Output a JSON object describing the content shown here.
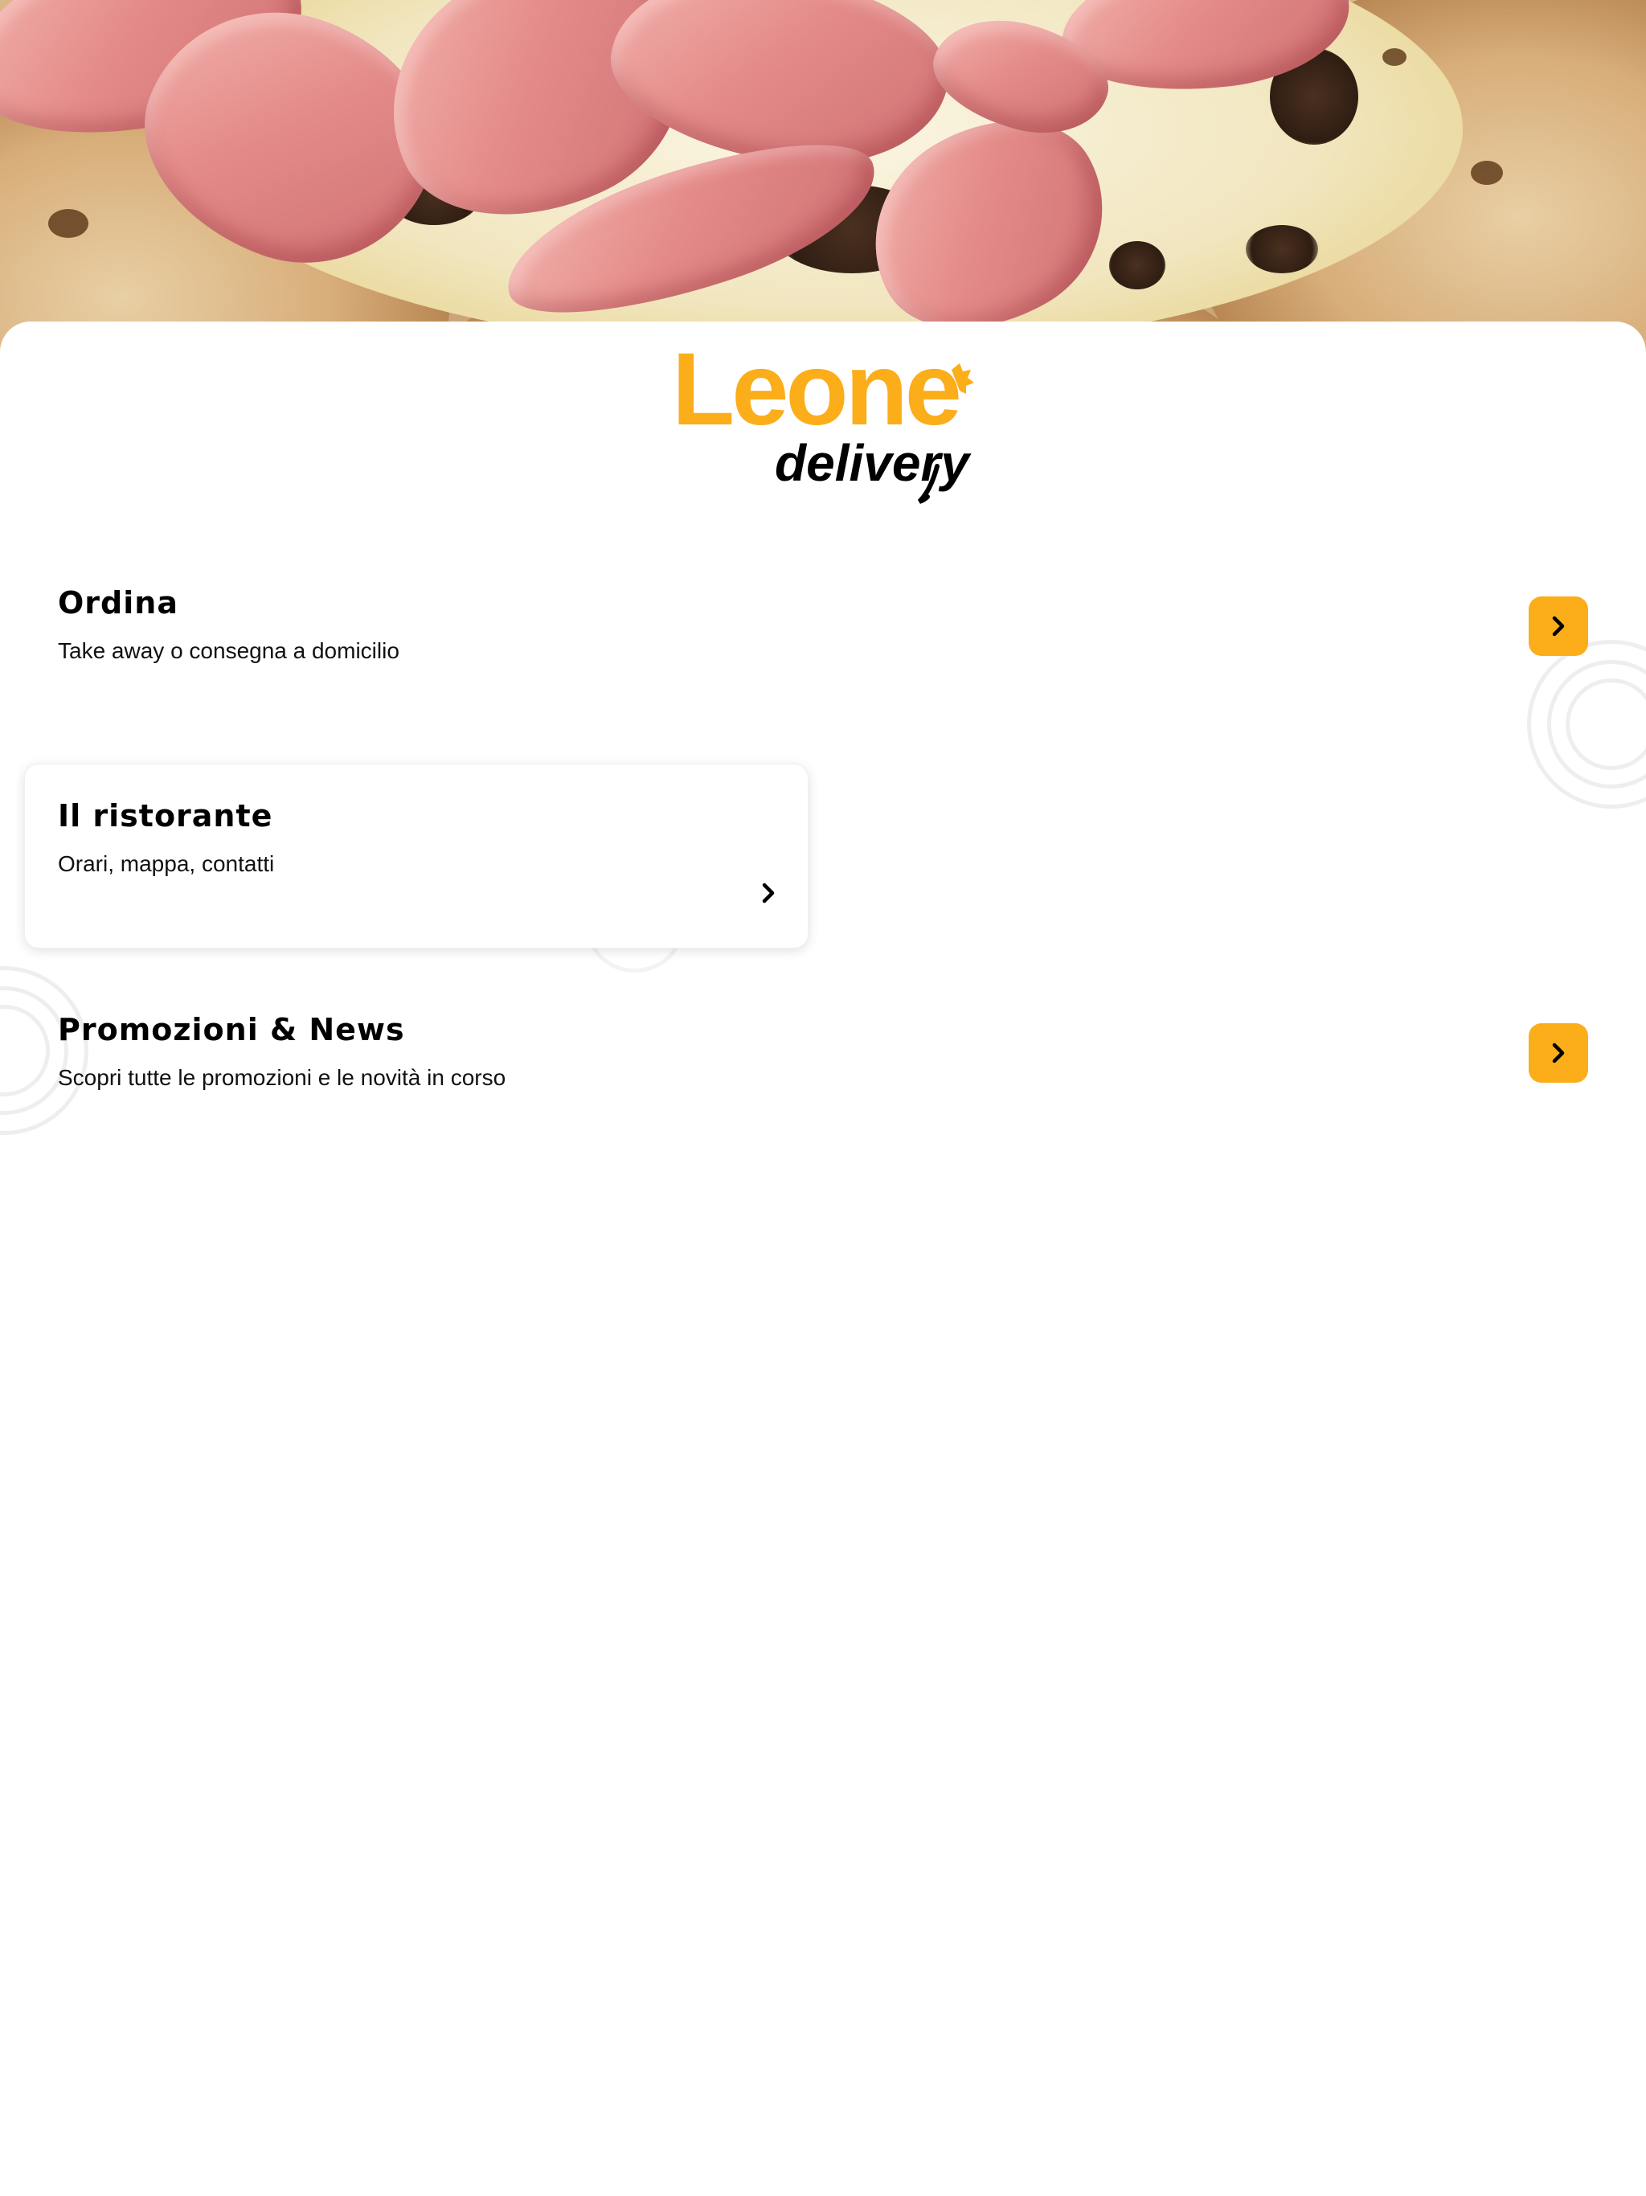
{
  "hero": {
    "image": "pizza with prosciutto cotto and truffle"
  },
  "brand": {
    "name": "Leone",
    "tagline": "delivery",
    "color": "#fbad1a"
  },
  "menu": [
    {
      "title": "Ordina",
      "subtitle": "Take away o consegna a domicilio",
      "icon": "chevron-right-icon"
    },
    {
      "title": "Il ristorante",
      "subtitle": "Orari, mappa, contatti",
      "icon": "chevron-right-icon"
    },
    {
      "title": "Promozioni & News",
      "subtitle": "Scopri tutte le promozioni e le novità in corso",
      "icon": "chevron-right-icon"
    }
  ],
  "colors": {
    "accent": "#fbad1a",
    "text": "#000000",
    "background": "#ffffff"
  }
}
